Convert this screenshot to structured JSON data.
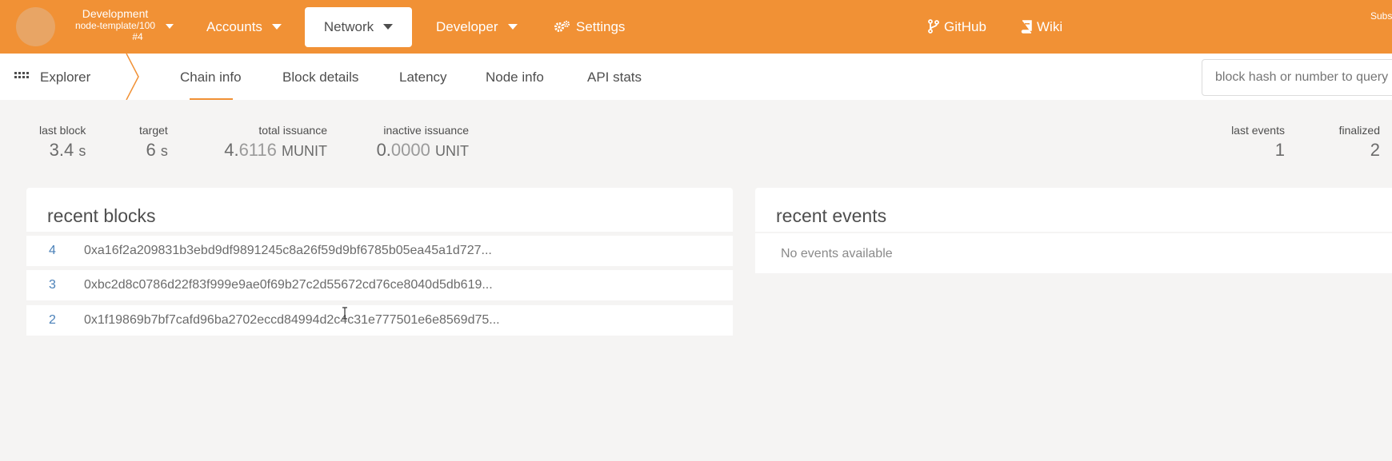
{
  "topbar": {
    "chain_name": "Development",
    "chain_runtime": "node-template/100",
    "chain_block": "#4",
    "nav": {
      "accounts": "Accounts",
      "network": "Network",
      "developer": "Developer",
      "settings": "Settings",
      "github": "GitHub",
      "wiki": "Wiki"
    },
    "right_label": "Subs"
  },
  "subnav": {
    "section": "Explorer",
    "tabs": [
      "Chain info",
      "Block details",
      "Latency",
      "Node info",
      "API stats"
    ],
    "active_tab": "Chain info",
    "search_placeholder": "block hash or number to query"
  },
  "stats": {
    "last_block": {
      "label": "last block",
      "value": "3.4",
      "unit": "s"
    },
    "target": {
      "label": "target",
      "value": "6",
      "unit": "s"
    },
    "total_issuance": {
      "label": "total issuance",
      "int": "4.",
      "frac": "6116",
      "unit": "MUNIT"
    },
    "inactive_issuance": {
      "label": "inactive issuance",
      "int": "0.",
      "frac": "0000",
      "unit": "UNIT"
    },
    "last_events": {
      "label": "last events",
      "value": "1"
    },
    "finalized": {
      "label": "finalized",
      "value": "2"
    }
  },
  "recent_blocks": {
    "title": "recent blocks",
    "rows": [
      {
        "number": "4",
        "hash": "0xa16f2a209831b3ebd9df9891245c8a26f59d9bf6785b05ea45a1d727..."
      },
      {
        "number": "3",
        "hash": "0xbc2d8c0786d22f83f999e9ae0f69b27c2d55672cd76ce8040d5db619..."
      },
      {
        "number": "2",
        "hash": "0x1f19869b7bf7cafd96ba2702eccd84994d2c4c31e777501e6e8569d75..."
      }
    ]
  },
  "recent_events": {
    "title": "recent events",
    "empty": "No events available"
  },
  "colors": {
    "accent": "#f19135",
    "link": "#4a80b8",
    "background": "#f5f4f3"
  }
}
